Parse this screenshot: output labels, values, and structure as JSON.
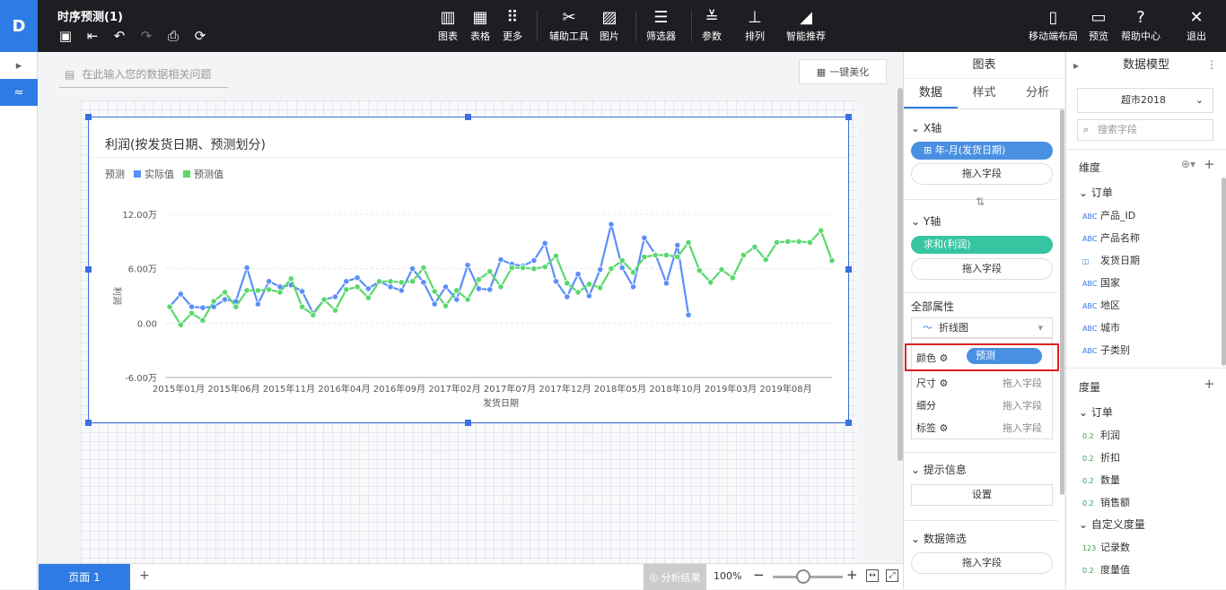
{
  "app": {
    "title": "时序预测(1)"
  },
  "toolbar": {
    "groups": [
      {
        "label": "图表",
        "icon": "bar-chart-icon"
      },
      {
        "label": "表格",
        "icon": "table-icon"
      },
      {
        "label": "更多",
        "icon": "grid-icon"
      },
      {
        "label": "辅助工具",
        "icon": "tools-icon"
      },
      {
        "label": "图片",
        "icon": "image-icon"
      },
      {
        "label": "筛选器",
        "icon": "filter-icon"
      },
      {
        "label": "参数",
        "icon": "params-icon"
      },
      {
        "label": "排列",
        "icon": "arrange-icon"
      },
      {
        "label": "智能推荐",
        "icon": "smart-icon"
      }
    ],
    "right": [
      {
        "label": "移动端布局",
        "icon": "mobile-icon"
      },
      {
        "label": "预览",
        "icon": "preview-icon"
      },
      {
        "label": "帮助中心",
        "icon": "help-icon"
      },
      {
        "label": "退出",
        "icon": "close-icon"
      }
    ]
  },
  "ask": {
    "placeholder": "在此输入您的数据相关问题"
  },
  "beautify": {
    "label": "一键美化"
  },
  "chart_data": {
    "type": "line",
    "title": "利润(按发货日期、预测划分)",
    "legend_title": "预测",
    "xlabel": "发货日期",
    "ylabel": "利润",
    "ylim": [
      -6,
      12
    ],
    "ytick_labels": [
      "12.00万",
      "6.00万",
      "0.00",
      "-6.00万"
    ],
    "yticks": [
      12,
      6,
      0,
      -6
    ],
    "xtick_labels": [
      "2015年01月",
      "2015年06月",
      "2015年11月",
      "2016年04月",
      "2016年09月",
      "2017年02月",
      "2017年07月",
      "2017年12月",
      "2018年05月",
      "2018年10月",
      "2019年03月",
      "2019年08月"
    ],
    "xtick_index": [
      0,
      5,
      10,
      15,
      20,
      25,
      30,
      35,
      40,
      45,
      50,
      55
    ],
    "n_points": 61,
    "grid": true,
    "legend_position": "top-left",
    "series": [
      {
        "name": "实际值",
        "color": "#5b8ff9",
        "start": 0,
        "values": [
          1.8,
          3.2,
          1.8,
          1.7,
          1.8,
          2.6,
          2.4,
          6.1,
          2.1,
          4.6,
          4.0,
          4.2,
          3.5,
          1.1,
          2.6,
          2.9,
          4.6,
          5.0,
          3.8,
          4.6,
          4.0,
          3.6,
          6.0,
          4.5,
          2.1,
          4.0,
          2.6,
          6.4,
          3.8,
          3.7,
          7.0,
          6.5,
          6.3,
          6.9,
          8.8,
          4.6,
          2.9,
          5.4,
          3.0,
          5.9,
          10.9,
          6.1,
          4.0,
          9.4,
          7.6,
          4.4,
          8.6,
          0.9
        ]
      },
      {
        "name": "预测值",
        "color": "#5ad86e",
        "start": 0,
        "values": [
          1.8,
          -0.2,
          1.1,
          0.3,
          2.4,
          3.4,
          1.8,
          3.6,
          3.6,
          3.7,
          3.4,
          4.9,
          1.8,
          0.9,
          2.6,
          1.4,
          3.7,
          4.0,
          2.8,
          4.6,
          4.6,
          4.5,
          4.6,
          6.1,
          3.5,
          1.9,
          3.6,
          2.6,
          4.8,
          5.7,
          4.0,
          6.1,
          6.1,
          6.0,
          6.2,
          7.4,
          4.4,
          3.4,
          4.3,
          3.9,
          6.0,
          6.9,
          5.6,
          7.3,
          7.5,
          7.5,
          7.3,
          8.9,
          5.8,
          4.5,
          5.9,
          5.0,
          7.5,
          8.4,
          7.0,
          8.9,
          9.0,
          9.0,
          8.9,
          10.2,
          6.9
        ]
      }
    ]
  },
  "bottom": {
    "page_tab": "页面 1",
    "add": "+",
    "analysis": "分析结果",
    "zoom": "100%",
    "minus": "−",
    "plus": "+"
  },
  "panel": {
    "title": "图表",
    "tabs": [
      "数据",
      "样式",
      "分析"
    ],
    "x_axis": {
      "label": "X轴",
      "field": "年-月(发货日期)",
      "drop": "拖入字段"
    },
    "swap": "⇅",
    "y_axis": {
      "label": "Y轴",
      "field": "求和(利润)",
      "drop": "拖入字段"
    },
    "all_props": "全部属性",
    "chart_type": "折线图",
    "props": [
      {
        "label": "颜色",
        "value": "预测"
      },
      {
        "label": "尺寸",
        "value": "拖入字段"
      },
      {
        "label": "细分",
        "value": "拖入字段"
      },
      {
        "label": "标签",
        "value": "拖入字段"
      }
    ],
    "tooltip": {
      "label": "提示信息",
      "button": "设置"
    },
    "filter": {
      "label": "数据筛选",
      "drop": "拖入字段"
    }
  },
  "model": {
    "title": "数据模型",
    "dataset": "超市2018",
    "search_placeholder": "搜索字段",
    "dimensions_label": "维度",
    "dim_group": "订单",
    "dimensions": [
      {
        "type": "ABC",
        "name": "产品_ID"
      },
      {
        "type": "ABC",
        "name": "产品名称"
      },
      {
        "type": "DATE",
        "name": "发货日期"
      },
      {
        "type": "ABC",
        "name": "国家"
      },
      {
        "type": "ABC",
        "name": "地区"
      },
      {
        "type": "ABC",
        "name": "城市"
      },
      {
        "type": "ABC",
        "name": "子类别"
      }
    ],
    "measures_label": "度量",
    "measure_group": "订单",
    "measures": [
      {
        "type": "0.2",
        "name": "利润"
      },
      {
        "type": "0.2",
        "name": "折扣"
      },
      {
        "type": "0.2",
        "name": "数量"
      },
      {
        "type": "0.2",
        "name": "销售额"
      }
    ],
    "custom_group": "自定义度量",
    "custom": [
      {
        "type": "123",
        "name": "记录数"
      },
      {
        "type": "0.2",
        "name": "度量值"
      }
    ]
  },
  "colors": {
    "accent": "#2f7be5",
    "actual": "#5b8ff9",
    "forecast": "#5ad86e",
    "y_pill": "#36c5a0",
    "highlight": "#e02020"
  }
}
